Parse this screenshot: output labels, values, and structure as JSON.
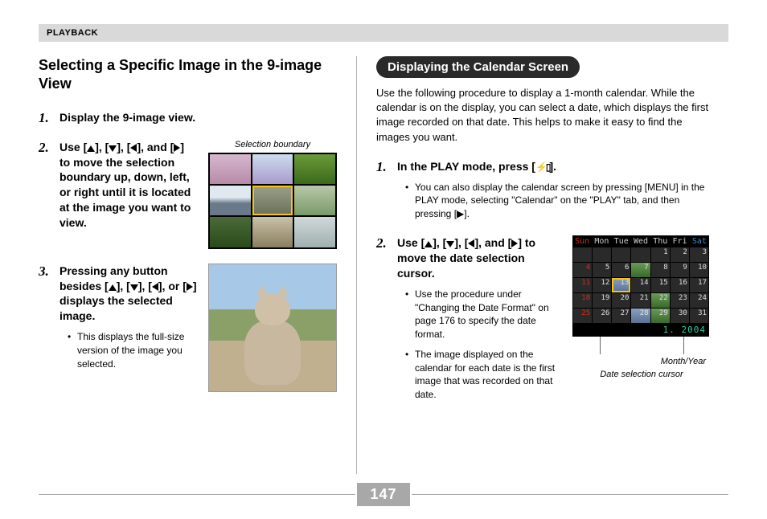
{
  "header": {
    "section": "PLAYBACK"
  },
  "page_number": "147",
  "left": {
    "title": "Selecting a Specific Image in the 9-image View",
    "steps": [
      {
        "head": "Display the 9-image view."
      },
      {
        "head_parts": [
          "Use [",
          "], [",
          "], [",
          "], and [",
          "] to move the selection boundary up, down, left, or right until it is located at the image you want to view."
        ],
        "fig_caption": "Selection boundary"
      },
      {
        "head_parts": [
          "Pressing any button besides [",
          "], [",
          "], [",
          "], or [",
          "] displays the selected image."
        ],
        "bullets": [
          "This displays the full-size version of the image you selected."
        ]
      }
    ]
  },
  "right": {
    "pill": "Displaying the Calendar Screen",
    "intro": "Use the following procedure to display a 1-month calendar. While the calendar is on the display, you can select a date, which displays the first image recorded on that date. This helps to make it easy to find the images you want.",
    "steps": [
      {
        "head_pre": "In the PLAY mode, press [",
        "head_post": "].",
        "bullets": [
          "You can also display the calendar screen by pressing [MENU] in the PLAY mode, selecting \"Calendar\" on the \"PLAY\" tab, and then pressing [▶]."
        ]
      },
      {
        "head_parts": [
          "Use [",
          "], [",
          "], [",
          "], and [",
          "] to move the date selection cursor."
        ],
        "bullets": [
          "Use the procedure under \"Changing the Date Format\" on page 176 to specify the date format.",
          "The image displayed on the calendar for each date is the first image that was recorded on that date."
        ],
        "annot1": "Month/Year",
        "annot2": "Date selection cursor"
      }
    ],
    "calendar": {
      "days": [
        "Sun",
        "Mon",
        "Tue",
        "Wed",
        "Thu",
        "Fri",
        "Sat"
      ],
      "month_year": "1. 2004",
      "cells": [
        "",
        "",
        "",
        "",
        "1",
        "2",
        "3",
        "4",
        "5",
        "6",
        "7",
        "8",
        "9",
        "10",
        "11",
        "12",
        "13",
        "14",
        "15",
        "16",
        "17",
        "18",
        "19",
        "20",
        "21",
        "22",
        "23",
        "24",
        "25",
        "26",
        "27",
        "28",
        "29",
        "30",
        "31"
      ]
    }
  }
}
